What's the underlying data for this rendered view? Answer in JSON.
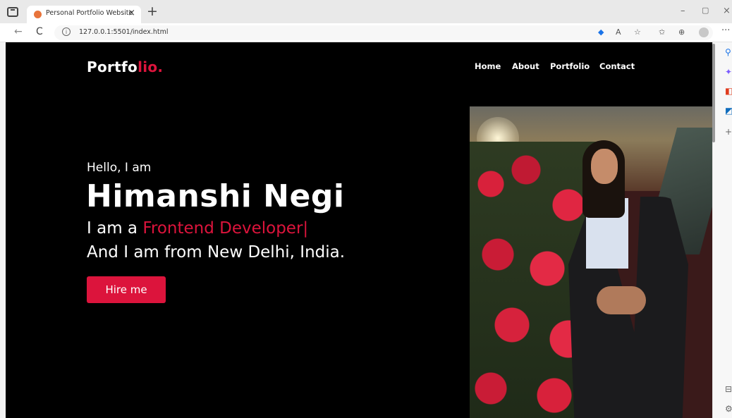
{
  "browser": {
    "tab_title": "Personal Portfolio Website",
    "tab_close": "×",
    "new_tab": "+",
    "url": "127.0.0.1:5501/index.html",
    "back": "←",
    "refresh": "C",
    "info": "i",
    "minimize": "–",
    "restore": "▢",
    "close": "×",
    "more": "···",
    "toolbar_icons": [
      "tag-icon",
      "read-aloud-icon",
      "favorite-add-icon",
      "favorites-icon",
      "collections-icon",
      "profile-icon"
    ]
  },
  "site": {
    "logo_main": "Portfo",
    "logo_accent": "lio.",
    "nav": [
      "Home",
      "About",
      "Portfolio",
      "Contact"
    ],
    "hello": "Hello, I am",
    "name": "Himanshi Negi",
    "role_prefix": "I am a ",
    "role": "Frontend Developer",
    "cursor": "|",
    "location": "And I am from New Delhi, India.",
    "hire_button": "Hire me",
    "accent_color": "#dc143c"
  },
  "sidebar": {
    "icons": [
      "search-icon",
      "copilot-icon",
      "office-icon",
      "outlook-icon",
      "add-icon",
      "split-screen-icon",
      "settings-icon"
    ]
  }
}
